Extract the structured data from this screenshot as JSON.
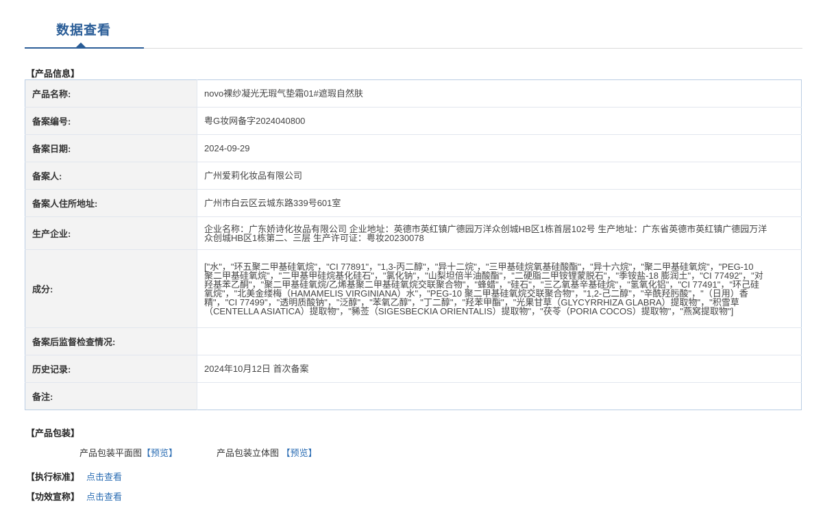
{
  "tab": {
    "title": "数据查看"
  },
  "product_info": {
    "heading": "【产品信息】",
    "rows": [
      {
        "label": "产品名称:",
        "value": "novo裸纱凝光无瑕气垫霜01#遮瑕自然肤"
      },
      {
        "label": "备案编号:",
        "value": "粤G妆网备字2024040800"
      },
      {
        "label": "备案日期:",
        "value": "2024-09-29"
      },
      {
        "label": "备案人:",
        "value": "广州爱莉化妆品有限公司"
      },
      {
        "label": "备案人住所地址:",
        "value": "广州市白云区云城东路339号601室"
      },
      {
        "label": "生产企业:",
        "value": "企业名称：广东娇诗化妆品有限公司 企业地址：英德市英红镇广德园万洋众创城HB区1栋首层102号 生产地址：广东省英德市英红镇广德园万洋众创城HB区1栋第二、三层 生产许可证：粤妆20230078"
      },
      {
        "label": "成分:",
        "value": "[\"水\"，\"环五聚二甲基硅氧烷\"，\"CI 77891\"，\"1,3-丙二醇\"，\"异十二烷\"，\"三甲基硅烷氧基硅酸酯\"，\"异十六烷\"，\"聚二甲基硅氧烷\"，\"PEG-10 聚二甲基硅氧烷\"，\"二甲基甲硅烷基化硅石\"，\"氯化钠\"，\"山梨坦倍半油酸酯\"，\"二硬脂二甲铵锂蒙脱石\"，\"季铵盐-18 膨润土\"，\"CI 77492\"，\"对羟基苯乙酮\"，\"聚二甲基硅氧烷/乙烯基聚二甲基硅氧烷交联聚合物\"，\"蜂蜡\"，\"硅石\"，\"三乙氧基辛基硅烷\"，\"氢氧化铝\"，\"CI 77491\"，\"环己硅氧烷\"，\"北美金缕梅（HAMAMELIS VIRGINIANA）水\"，\"PEG-10 聚二甲基硅氧烷交联聚合物\"，\"1,2-己二醇\"，\"辛酰羟肟酸\"，\"（日用）香精\"，\"CI 77499\"，\"透明质酸钠\"，\"泛醇\"，\"苯氧乙醇\"，\"丁二醇\"，\"羟苯甲酯\"，\"光果甘草（GLYCYRRHIZA GLABRA）提取物\"，\"积雪草（CENTELLA ASIATICA）提取物\"，\"豨莶（SIGESBECKIA ORIENTALIS）提取物\"，\"茯苓（PORIA COCOS）提取物\"，\"燕窝提取物\"]"
      },
      {
        "label": "备案后监督检查情况:",
        "value": ""
      },
      {
        "label": "历史记录:",
        "value": "2024年10月12日 首次备案"
      },
      {
        "label": "备注:",
        "value": ""
      }
    ]
  },
  "packaging": {
    "heading": "【产品包装】",
    "flat_label": "产品包装平面图",
    "flat_link": "【预览】",
    "solid_label": "产品包装立体图",
    "solid_link": "【预览】"
  },
  "standard": {
    "heading": "【执行标准】",
    "link": "点击查看"
  },
  "efficacy": {
    "heading": "【功效宣称】",
    "link": "点击查看"
  }
}
